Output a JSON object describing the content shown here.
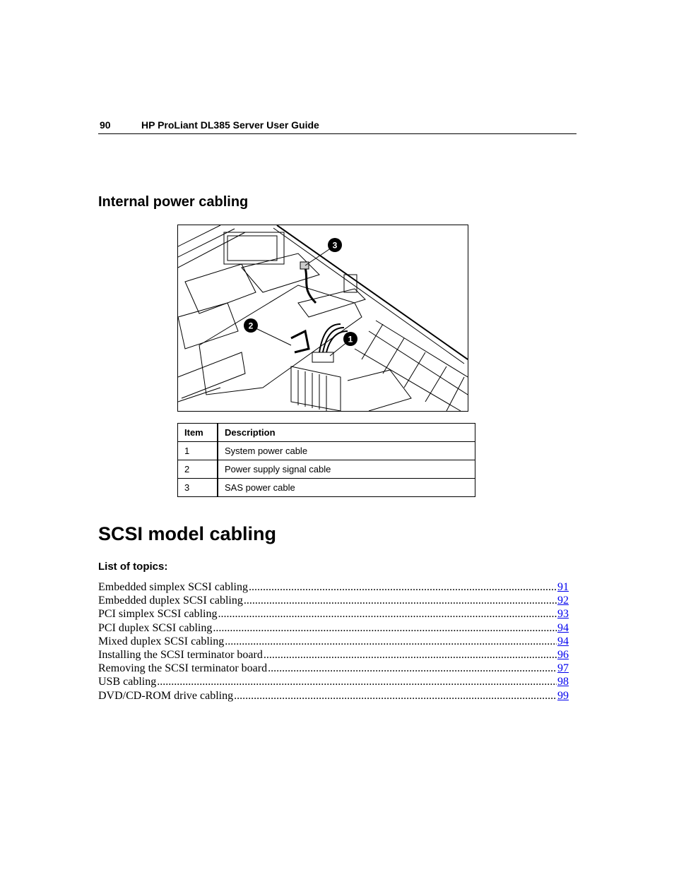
{
  "header": {
    "page_number": "90",
    "title": "HP ProLiant DL385 Server User Guide"
  },
  "section": {
    "heading": "Internal power cabling",
    "figure": {
      "description": "Line drawing of server internals showing power cable routing",
      "callouts": [
        "1",
        "2",
        "3"
      ]
    },
    "table": {
      "headers": [
        "Item",
        "Description"
      ],
      "rows": [
        [
          "1",
          "System power cable"
        ],
        [
          "2",
          "Power supply signal cable"
        ],
        [
          "3",
          "SAS power cable"
        ]
      ]
    }
  },
  "chapter": {
    "heading": "SCSI model cabling",
    "list_heading": "List of topics:",
    "topics": [
      {
        "title": "Embedded simplex SCSI cabling",
        "page": "91"
      },
      {
        "title": "Embedded duplex SCSI cabling",
        "page": "92"
      },
      {
        "title": "PCI simplex SCSI cabling",
        "page": "93"
      },
      {
        "title": "PCI duplex SCSI cabling",
        "page": "94"
      },
      {
        "title": "Mixed duplex SCSI cabling",
        "page": "94"
      },
      {
        "title": "Installing the SCSI terminator board",
        "page": "96"
      },
      {
        "title": "Removing the SCSI terminator board",
        "page": "97"
      },
      {
        "title": "USB cabling",
        "page": "98"
      },
      {
        "title": "DVD/CD-ROM drive cabling",
        "page": "99"
      }
    ]
  },
  "colors": {
    "link": "#0000ee",
    "text": "#000000"
  }
}
